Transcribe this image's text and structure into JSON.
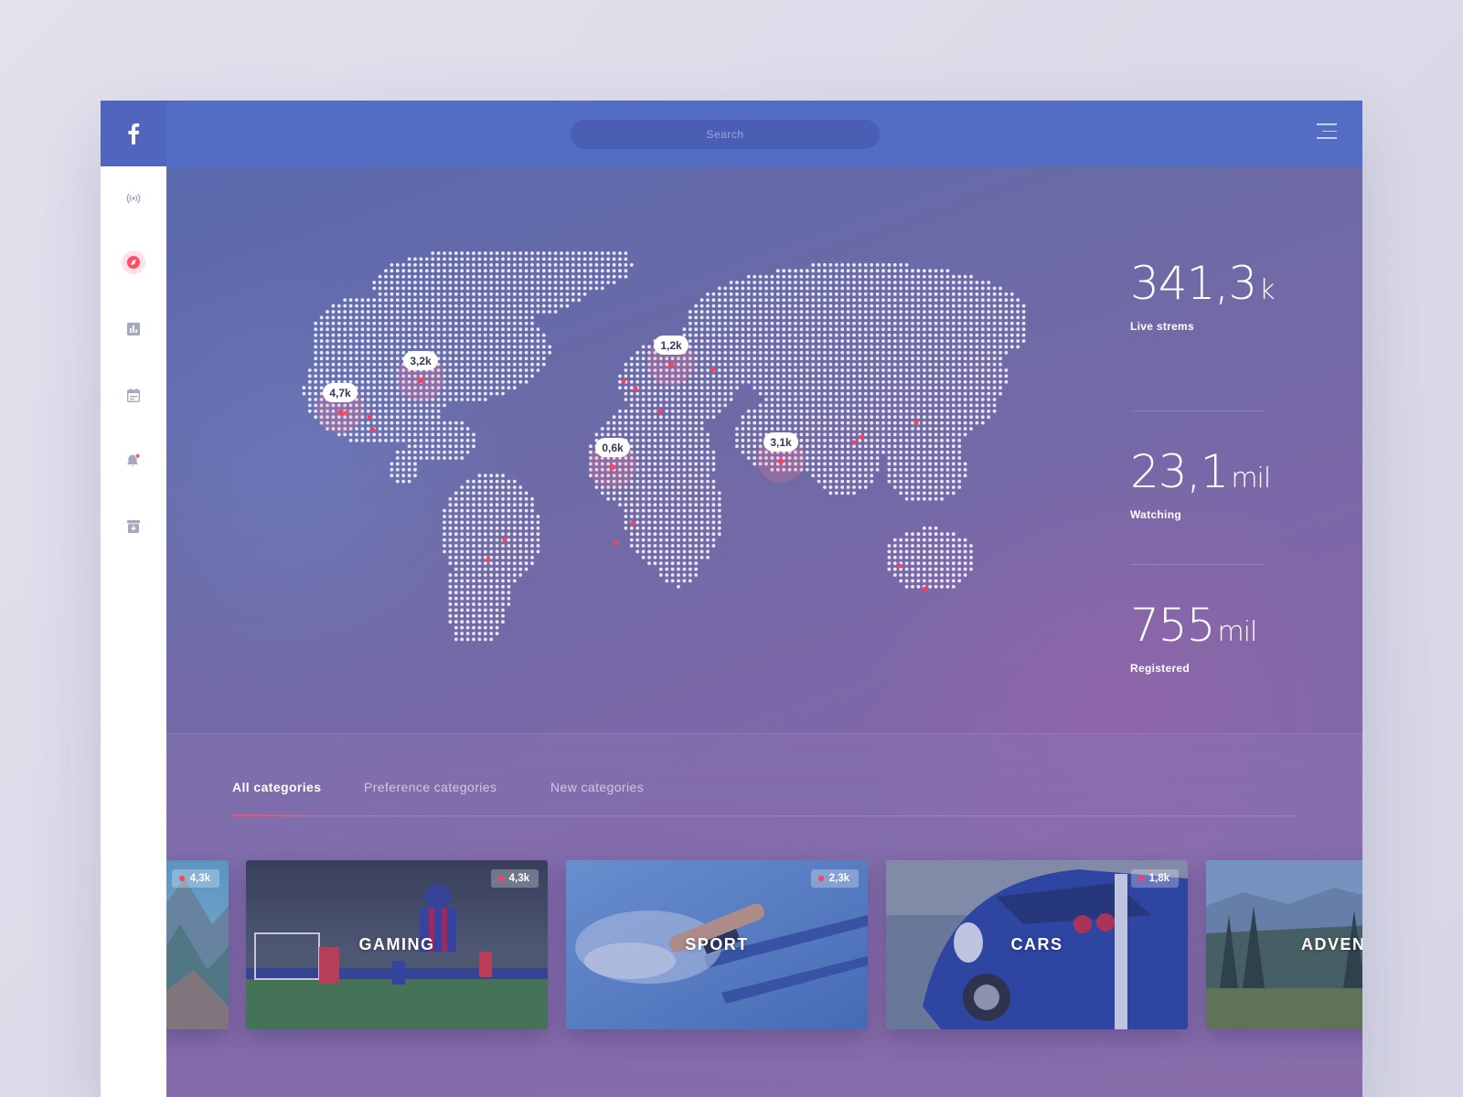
{
  "header": {
    "search_placeholder": "Search",
    "logo_letter": "f"
  },
  "colors": {
    "brand": "#536cc4",
    "accent": "#ff3d5c"
  },
  "sidebar": {
    "items": [
      {
        "icon": "broadcast-icon",
        "active": false
      },
      {
        "icon": "compass-icon",
        "active": true
      },
      {
        "icon": "bar-chart-icon",
        "active": false
      },
      {
        "icon": "calendar-icon",
        "active": false
      },
      {
        "icon": "bell-icon",
        "active": false,
        "notification": true
      },
      {
        "icon": "archive-icon",
        "active": false
      }
    ]
  },
  "map": {
    "markers": [
      {
        "label": "4,7k",
        "region": "us-west"
      },
      {
        "label": "3,2k",
        "region": "us-northeast"
      },
      {
        "label": "1,2k",
        "region": "europe"
      },
      {
        "label": "0,6k",
        "region": "west-africa"
      },
      {
        "label": "3,1k",
        "region": "india"
      }
    ]
  },
  "stats": [
    {
      "value": "341,3",
      "unit": "k",
      "label": "Live strems"
    },
    {
      "value": "23,1",
      "unit": "mil",
      "label": "Watching"
    },
    {
      "value": "755",
      "unit": "mil",
      "label": "Registered"
    }
  ],
  "tabs": [
    {
      "label": "All categories",
      "active": true
    },
    {
      "label": "Preference categories",
      "active": false
    },
    {
      "label": "New categories",
      "active": false
    }
  ],
  "cards": [
    {
      "title": "",
      "count": "4,3k"
    },
    {
      "title": "GAMING",
      "count": "4,3k"
    },
    {
      "title": "SPORT",
      "count": "2,3k"
    },
    {
      "title": "CARS",
      "count": "1,8k"
    },
    {
      "title": "ADVEN",
      "count": ""
    }
  ]
}
